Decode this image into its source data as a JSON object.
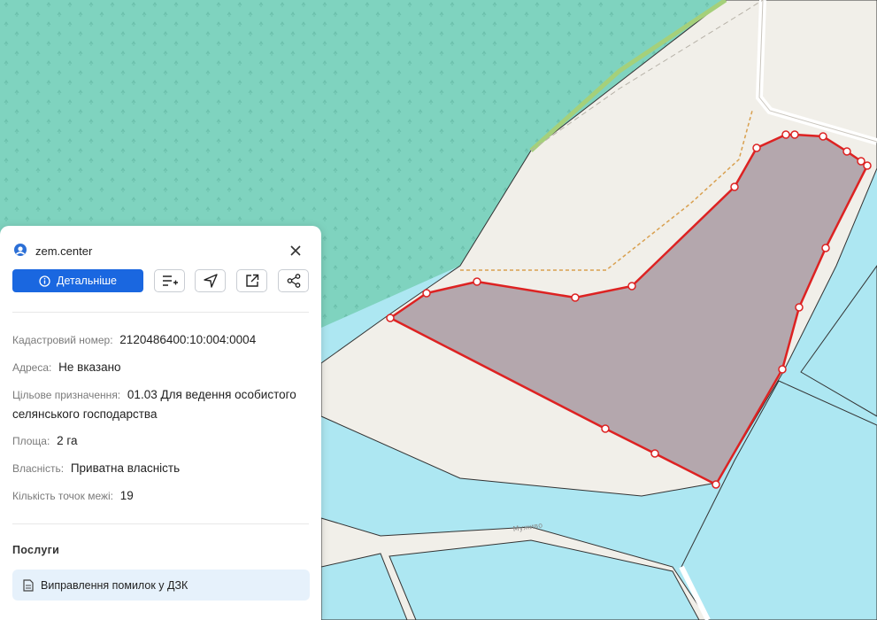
{
  "map": {
    "road_label": "Муживо",
    "parcel_point_count": 19,
    "colors": {
      "water": "#ade7f2",
      "forest": "#7fd3bf",
      "land": "#f1efe9",
      "parcel_fill": "#b4a7ad",
      "parcel_stroke": "#dd2222"
    }
  },
  "panel": {
    "brand": "zem.center",
    "details_button": "Детальніше",
    "fields": {
      "cadastral_label": "Кадастровий номер:",
      "cadastral_value": "2120486400:10:004:0004",
      "address_label": "Адреса:",
      "address_value": "Не вказано",
      "purpose_label": "Цільове призначення:",
      "purpose_value": "01.03 Для ведення особистого селянського господарства",
      "area_label": "Площа:",
      "area_value": "2 га",
      "ownership_label": "Власність:",
      "ownership_value": "Приватна власність",
      "points_label": "Кількість точок межі:",
      "points_value": "19"
    },
    "services_title": "Послуги",
    "services": [
      {
        "label": "Виправлення помилок у ДЗК"
      }
    ]
  }
}
